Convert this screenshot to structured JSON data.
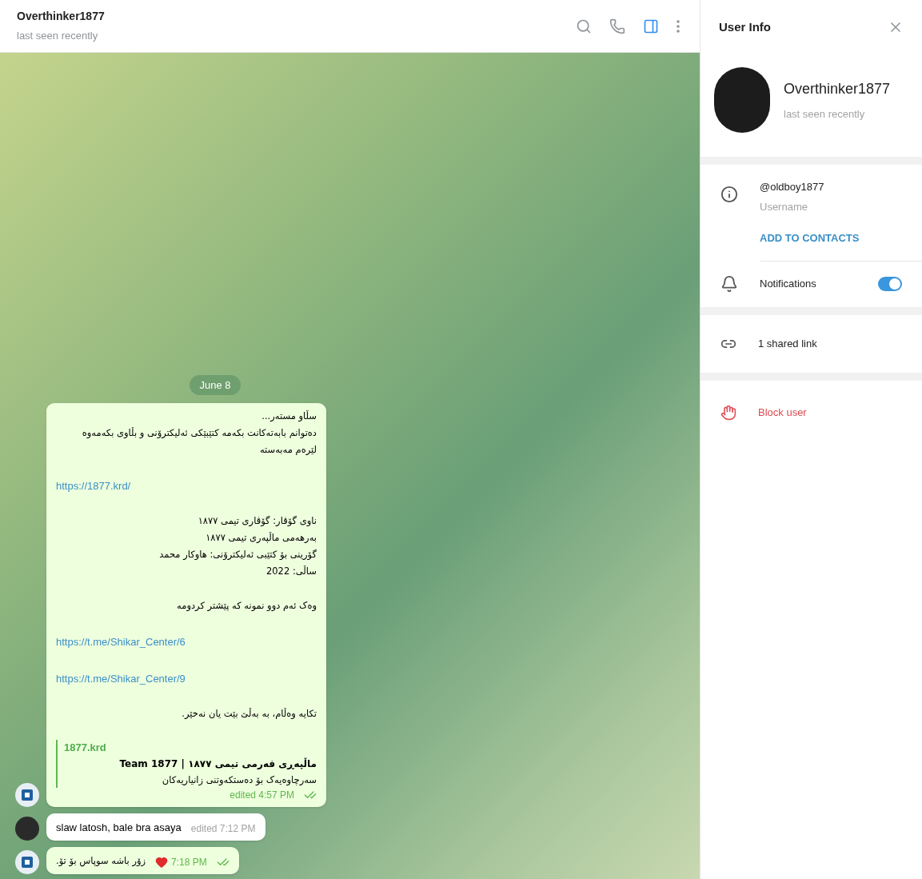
{
  "chat_header": {
    "title": "Overthinker1877",
    "status": "last seen recently",
    "actions": [
      {
        "kind": "search",
        "selected": false
      },
      {
        "kind": "call",
        "selected": false
      },
      {
        "kind": "sidebar",
        "selected": true
      },
      {
        "kind": "more",
        "selected": false
      }
    ]
  },
  "date_label": "June 8",
  "messages": [
    {
      "outgoing": true,
      "reaction": false,
      "time": "edited 4:57 PM",
      "parts": [
        {
          "kind": "text",
          "lines": [
            "سڵاو مستەر...",
            "دەتوانم بابەتەکانت بکەمە کتێبێکی ئەلیکترۆنی و بڵاوی بکەمەوە",
            "لێرەم مەبەستە"
          ]
        },
        {
          "kind": "link",
          "text": "https://1877.krd/"
        },
        {
          "kind": "text",
          "lines": [
            "ناوی گۆڤار: گۆڤاری تیمی ١٨٧٧",
            "بەرهەمی ماڵپەری تیمی ١٨٧٧",
            "گۆرینی بۆ کتێبی ئەلیکترۆنی: هاوکار محمد",
            "ساڵی: 2022"
          ]
        },
        {
          "kind": "text",
          "lines": [
            "وەک ئەم دوو نمونە کە پێشتر کردومە"
          ]
        },
        {
          "kind": "link",
          "text": "https://t.me/Shikar_Center/6"
        },
        {
          "kind": "link",
          "text": "https://t.me/Shikar_Center/9"
        },
        {
          "kind": "text",
          "lines": [
            "تکایە وەڵام، بە بەڵێ بێت یان نەخێر."
          ]
        },
        {
          "kind": "preview",
          "site": "1877.krd",
          "title": "ماڵپەڕی فەرمی تیمی ١٨٧٧ | Team 1877",
          "description": "سەرچاوەیەک بۆ دەستکەوتنی زانیاریەکان"
        }
      ]
    },
    {
      "outgoing": false,
      "reaction": false,
      "time": "edited 7:12 PM",
      "parts": [
        {
          "kind": "text",
          "lines": [
            "slaw latosh, bale bra asaya"
          ]
        }
      ]
    },
    {
      "outgoing": true,
      "reaction": true,
      "time": "7:18 PM",
      "parts": [
        {
          "kind": "text",
          "lines": [
            "زۆر باشە سوپاس بۆ تۆ."
          ]
        }
      ]
    }
  ],
  "user_info": {
    "title": "User Info",
    "name": "Overthinker1877",
    "status": "last seen recently",
    "username": "@oldboy1877",
    "username_label": "Username",
    "add_contact": "ADD TO CONTACTS",
    "notifications": {
      "label": "Notifications",
      "on": true
    },
    "shared_links": "1 shared link",
    "block": "Block user"
  }
}
